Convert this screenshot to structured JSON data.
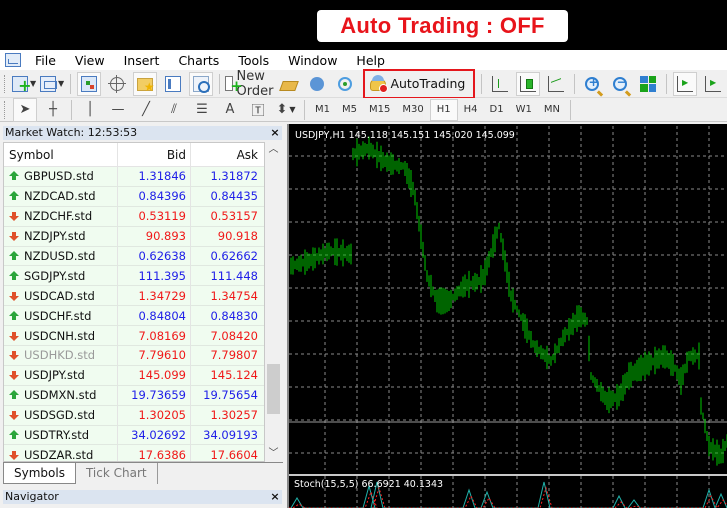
{
  "banner": {
    "text": "Auto Trading : OFF",
    "color": "#e8141b"
  },
  "menu": {
    "items": [
      "File",
      "View",
      "Insert",
      "Charts",
      "Tools",
      "Window",
      "Help"
    ]
  },
  "toolbar": {
    "new_order_label": "New Order",
    "autotrading_label": "AutoTrading",
    "autotrading_state": "off"
  },
  "timeframes": {
    "items": [
      "M1",
      "M5",
      "M15",
      "M30",
      "H1",
      "H4",
      "D1",
      "W1",
      "MN"
    ],
    "active": "H1"
  },
  "market_watch": {
    "title": "Market Watch: 12:53:53",
    "close_label": "×",
    "columns": {
      "symbol": "Symbol",
      "bid": "Bid",
      "ask": "Ask"
    },
    "rows": [
      {
        "symbol": "GBPUSD.std",
        "bid": "1.31846",
        "ask": "1.31872",
        "dir": "up"
      },
      {
        "symbol": "NZDCAD.std",
        "bid": "0.84396",
        "ask": "0.84435",
        "dir": "up"
      },
      {
        "symbol": "NZDCHF.std",
        "bid": "0.53119",
        "ask": "0.53157",
        "dir": "down"
      },
      {
        "symbol": "NZDJPY.std",
        "bid": "90.893",
        "ask": "90.918",
        "dir": "down"
      },
      {
        "symbol": "NZDUSD.std",
        "bid": "0.62638",
        "ask": "0.62662",
        "dir": "up"
      },
      {
        "symbol": "SGDJPY.std",
        "bid": "111.395",
        "ask": "111.448",
        "dir": "up"
      },
      {
        "symbol": "USDCAD.std",
        "bid": "1.34729",
        "ask": "1.34754",
        "dir": "down"
      },
      {
        "symbol": "USDCHF.std",
        "bid": "0.84804",
        "ask": "0.84830",
        "dir": "up"
      },
      {
        "symbol": "USDCNH.std",
        "bid": "7.08169",
        "ask": "7.08420",
        "dir": "down"
      },
      {
        "symbol": "USDHKD.std",
        "bid": "7.79610",
        "ask": "7.79807",
        "dir": "down",
        "dim": true
      },
      {
        "symbol": "USDJPY.std",
        "bid": "145.099",
        "ask": "145.124",
        "dir": "down"
      },
      {
        "symbol": "USDMXN.std",
        "bid": "19.73659",
        "ask": "19.75654",
        "dir": "up"
      },
      {
        "symbol": "USDSGD.std",
        "bid": "1.30205",
        "ask": "1.30257",
        "dir": "down"
      },
      {
        "symbol": "USDTRY.std",
        "bid": "34.02692",
        "ask": "34.09193",
        "dir": "up"
      },
      {
        "symbol": "USDZAR.std",
        "bid": "17.6386",
        "ask": "17.6604",
        "dir": "down"
      }
    ],
    "tabs": [
      "Symbols",
      "Tick Chart"
    ],
    "active_tab": "Symbols",
    "colors": {
      "up": "#2020e8",
      "down": "#f01818"
    }
  },
  "navigator": {
    "title": "Navigator",
    "close_label": "×"
  },
  "chart": {
    "symbol_info": "USDJPY,H1  145.118 145.151 145.020 145.099",
    "symbol": "USDJPY",
    "timeframe": "H1",
    "ohlc": {
      "open": "145.118",
      "high": "145.151",
      "low": "145.020",
      "close": "145.099"
    },
    "bar_color": "#00c800",
    "stoch_label": "Stoch(15,5,5) 66.6921 40.1343",
    "stoch": {
      "main": "66.6921",
      "signal": "40.1343",
      "main_color": "#20b2aa",
      "signal_color": "#ff2020"
    }
  }
}
